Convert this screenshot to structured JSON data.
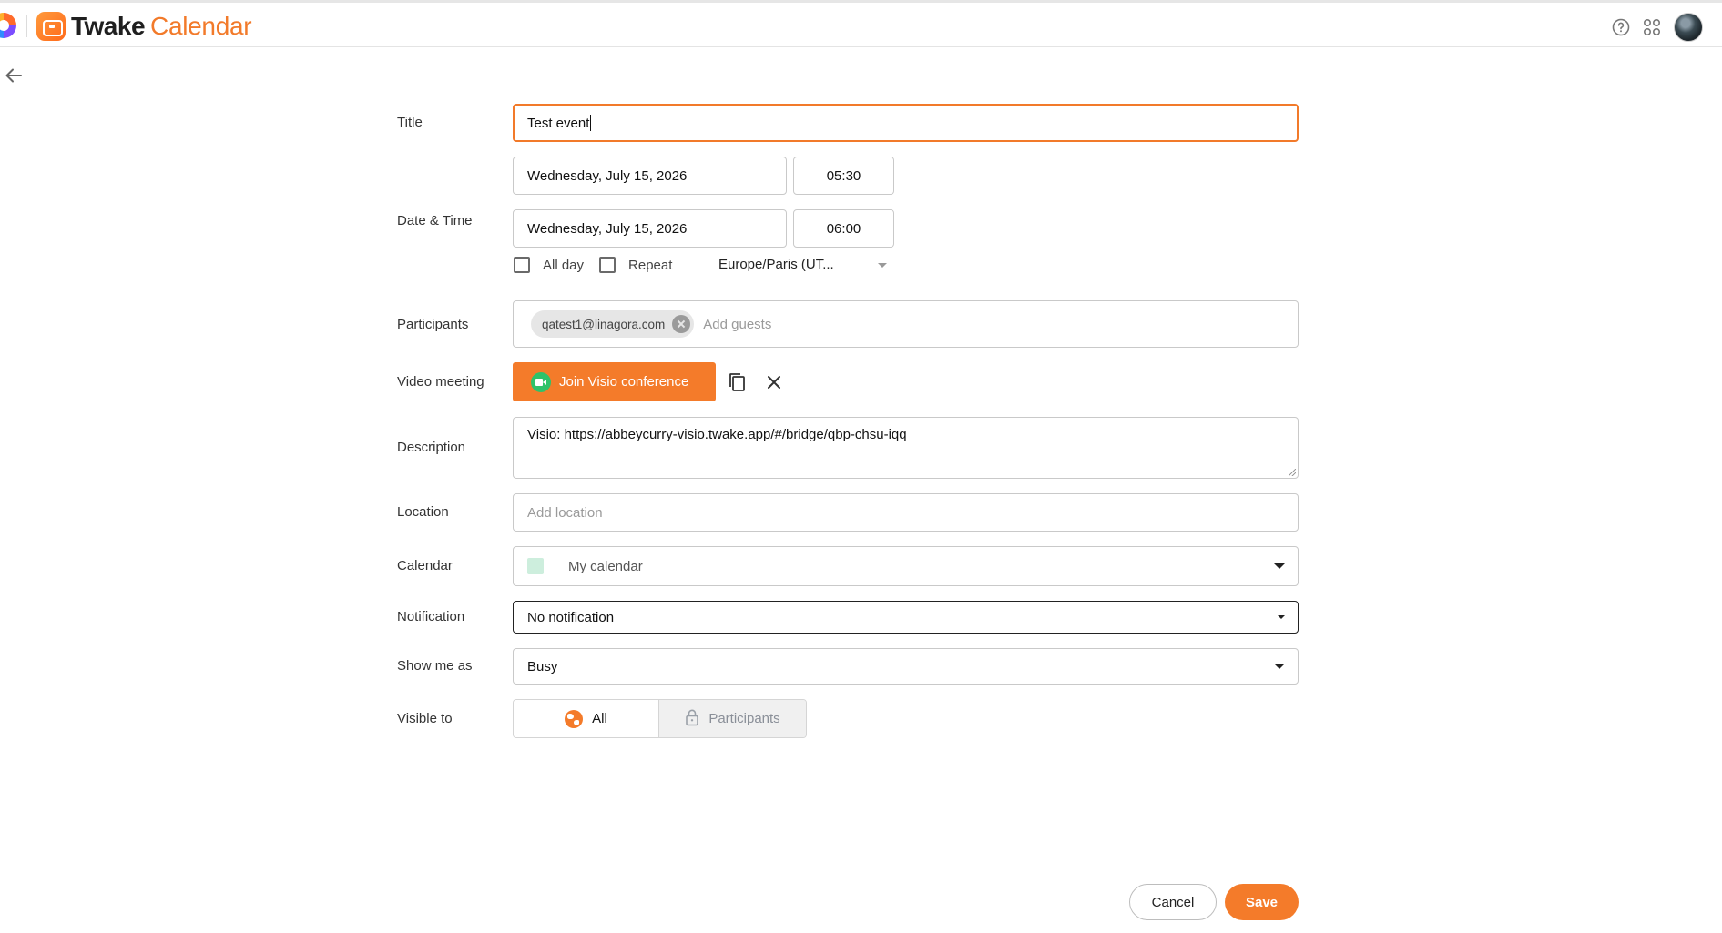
{
  "header": {
    "brand_primary": "Twake",
    "brand_secondary": "Calendar",
    "help_icon": "help-circle-icon",
    "apps_icon": "apps-grid-icon",
    "avatar_icon": "user-avatar"
  },
  "nav": {
    "back_icon": "arrow-left-icon"
  },
  "form": {
    "title": {
      "label": "Title",
      "value": "Test event"
    },
    "datetime": {
      "label": "Date & Time",
      "start_date": "Wednesday, July 15, 2026",
      "start_time": "05:30",
      "end_date": "Wednesday, July 15, 2026",
      "end_time": "06:00",
      "all_day_label": "All day",
      "all_day_checked": false,
      "repeat_label": "Repeat",
      "repeat_checked": false,
      "timezone": "Europe/Paris (UT..."
    },
    "participants": {
      "label": "Participants",
      "chips": [
        "qatest1@linagora.com"
      ],
      "placeholder": "Add guests"
    },
    "video": {
      "label": "Video meeting",
      "join_label": "Join Visio conference",
      "copy_icon": "copy-icon",
      "remove_icon": "close-icon"
    },
    "description": {
      "label": "Description",
      "value": "Visio: https://abbeycurry-visio.twake.app/#/bridge/qbp-chsu-iqq"
    },
    "location": {
      "label": "Location",
      "placeholder": "Add location"
    },
    "calendar": {
      "label": "Calendar",
      "value": "My calendar",
      "color": "#cdeedd"
    },
    "notification": {
      "label": "Notification",
      "value": "No notification"
    },
    "show_me_as": {
      "label": "Show me as",
      "value": "Busy"
    },
    "visible_to": {
      "label": "Visible to",
      "options": [
        "All",
        "Participants"
      ],
      "selected": "All"
    }
  },
  "actions": {
    "cancel_label": "Cancel",
    "save_label": "Save"
  },
  "colors": {
    "accent": "#f47b2a",
    "visio_icon": "#2ec26a"
  }
}
